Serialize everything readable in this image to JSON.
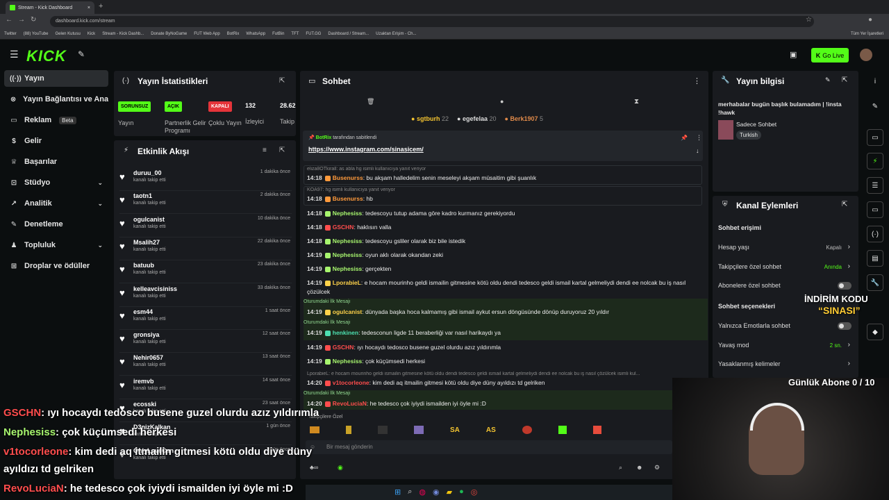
{
  "browser": {
    "tab_title": "Stream - Kick Dashboard",
    "url": "dashboard.kick.com/stream",
    "bookmarks": [
      "Twitter",
      "(88) YouTube",
      "Gelen Kutusu",
      "Kick",
      "Stream - Kick Dashb...",
      "Donate ByNoGame",
      "FUT Web App",
      "BotRix",
      "WhatsApp",
      "FutBin",
      "TFT",
      "FUT.GG",
      "Dashboard / Stream...",
      "Uzaktan Erişim - Ch..."
    ],
    "all_bookmarks": "Tüm Yer İşaretleri"
  },
  "header": {
    "logo": "KICK",
    "go_live": "Go Live"
  },
  "sidebar": {
    "items": [
      {
        "label": "Yayın",
        "icon": "broadcast-icon"
      },
      {
        "label": "Yayın Bağlantısı ve Anahtarı",
        "icon": "link-icon"
      },
      {
        "label": "Reklam",
        "icon": "ad-icon",
        "badge": "Beta"
      },
      {
        "label": "Gelir",
        "icon": "revenue-icon"
      },
      {
        "label": "Başarılar",
        "icon": "trophy-icon"
      },
      {
        "label": "Stüdyo",
        "icon": "studio-icon"
      },
      {
        "label": "Analitik",
        "icon": "analytics-icon"
      },
      {
        "label": "Denetleme",
        "icon": "moderation-icon"
      },
      {
        "label": "Topluluk",
        "icon": "community-icon"
      },
      {
        "label": "Droplar ve ödüller",
        "icon": "gift-icon"
      }
    ]
  },
  "stats": {
    "title": "Yayın İstatistikleri",
    "items": [
      {
        "badge": "SORUNSUZ",
        "label": "Yayın",
        "color": "#53fc18"
      },
      {
        "badge": "AÇIK",
        "label": "Partnerlik Gelir Programı",
        "color": "#53fc18"
      },
      {
        "badge": "KAPALI",
        "label": "Çoklu Yayın",
        "color": "#e5343a"
      },
      {
        "value": "132",
        "label": "İzleyici"
      },
      {
        "value": "28.62",
        "label": "Takip"
      }
    ]
  },
  "activity": {
    "title": "Etkinlik Akışı",
    "sub": "kanalı takip etti",
    "items": [
      {
        "name": "duruu_00",
        "time": "1 dakika önce"
      },
      {
        "name": "taotn1",
        "time": "2 dakika önce"
      },
      {
        "name": "ogulcanist",
        "time": "10 dakika önce"
      },
      {
        "name": "Msalih27",
        "time": "22 dakika önce"
      },
      {
        "name": "batuub",
        "time": "23 dakika önce"
      },
      {
        "name": "kelleavcisiniss",
        "time": "33 dakika önce"
      },
      {
        "name": "esm44",
        "time": "1 saat önce"
      },
      {
        "name": "gronsiya",
        "time": "12 saat önce"
      },
      {
        "name": "Nehir0657",
        "time": "13 saat önce"
      },
      {
        "name": "iremvb",
        "time": "14 saat önce"
      },
      {
        "name": "ecosski",
        "time": "23 saat önce"
      },
      {
        "name": "D3nizKalkan",
        "time": "1 gün önce"
      },
      {
        "name": "OnlyLoveCan",
        "time": "1 gün önce"
      }
    ]
  },
  "chat": {
    "title": "Sohbet",
    "top_users": [
      {
        "name": "sgtburh",
        "count": "22"
      },
      {
        "name": "egefelaa",
        "count": "20"
      },
      {
        "name": "Berk1907",
        "count": "5"
      }
    ],
    "pinned_by": "BotRix",
    "pinned_suffix": "tarafından sabitlendi",
    "pinned_link": "https://www.instagram.com/sinasicem/",
    "first_message_label": "Oturumdaki İlk Mesajı",
    "messages": [
      {
        "reply": "eliza8OTkirall: as abla hg isimli kullanıcıya yanıt veriyor",
        "time": "14:18",
        "user": "Busenurss",
        "color": "#ff9a3c",
        "text": "bu akşam halledelim senin meseleyi akşam müsaitim gibi şuanlık"
      },
      {
        "reply": "KOA97: hg isimli kullanıcıya yanıt veriyor",
        "time": "14:18",
        "user": "Busenurss",
        "color": "#ff9a3c",
        "text": "hb"
      },
      {
        "time": "14:18",
        "user": "Nephesiss",
        "color": "#a7f56e",
        "text": "tedescoyu tutup adama göre kadro kurmanız gerekiyordu"
      },
      {
        "time": "14:18",
        "user": "GSCHN",
        "color": "#ff4d4d",
        "text": "haklısın valla"
      },
      {
        "time": "14:18",
        "user": "Nephesiss",
        "color": "#a7f56e",
        "text": "tedescoyu gsliler olarak biz bile istedik"
      },
      {
        "time": "14:19",
        "user": "Nephesiss",
        "color": "#a7f56e",
        "text": "oyun aklı olarak okandan zeki"
      },
      {
        "time": "14:19",
        "user": "Nephesiss",
        "color": "#a7f56e",
        "text": "gerçekten"
      },
      {
        "time": "14:19",
        "user": "LporabieL",
        "color": "#ffd24a",
        "text": "e hocam mourinho geldi ismailin gitmesine kötü oldu dendi tedesco geldi ismail kartal gelmeliydi dendi ee nolcak bu iş nasıl çözülcek"
      },
      {
        "first": true,
        "time": "14:19",
        "user": "ogulcanist",
        "color": "#ffd24a",
        "text": "dünyada başka hoca kalmamış gibi ismail aykut ersun döngüsünde dönüp duruyoruz 20 yıldır"
      },
      {
        "first": true,
        "time": "14:19",
        "user": "henkinen",
        "color": "#4de0b0",
        "text": "tedesconun ligde 11 beraberliği var nasıl harikaydı ya"
      },
      {
        "time": "14:19",
        "user": "GSCHN",
        "color": "#ff4d4d",
        "text": "ıyı hocaydı tedosco busene guzel olurdu azız yıldırımla"
      },
      {
        "time": "14:19",
        "user": "Nephesiss",
        "color": "#a7f56e",
        "text": "çok küçümsedi herkesi"
      },
      {
        "reply": "LporabieL: e hocam mourinho geldi ismailin gitmesine kötü oldu dendi tedesco geldi ismail kartal gelmeliydi dendi ee nolcak bu iş nasıl çözülcek isimli kul...",
        "time": "14:20",
        "user": "v1tocorleone",
        "color": "#ff4d4d",
        "text": "kim dedi aq itmailin gitmesi kötü oldu diye düny ayıldızı td gelriken"
      },
      {
        "first": true,
        "time": "14:20",
        "user": "RevoLuciaN",
        "color": "#ff4d4d",
        "text": "he tedesco çok iyiydi ismailden iyi öyle mi :D"
      }
    ],
    "followers_only": "Takipçilere Özel",
    "emotes": [
      "SA",
      "AS"
    ],
    "input_placeholder": "Bir mesaj gönderin"
  },
  "stream_info": {
    "title": "Yayın bilgisi",
    "stream_title": "merhabalar bugün başlık bulamadım | !insta !hawk",
    "category": "Sadece Sohbet",
    "tag": "Turkish"
  },
  "channel_actions": {
    "title": "Kanal Eylemleri",
    "chat_access": "Sohbet erişimi",
    "rows1": [
      {
        "label": "Hesap yaşı",
        "value": "Kapalı",
        "color": "#bbbbbb"
      },
      {
        "label": "Takipçilere özel sohbet",
        "value": "Anında",
        "color": "#53fc18"
      },
      {
        "label": "Abonelere özel sohbet",
        "toggle": true
      }
    ],
    "chat_options": "Sohbet seçenekleri",
    "rows2": [
      {
        "label": "Yalnızca Emotlarla sohbet",
        "toggle": true
      },
      {
        "label": "Yavaş mod",
        "value": "2 sn.",
        "color": "#53fc18"
      },
      {
        "label": "Yasaklanmış kelimeler"
      }
    ]
  },
  "overlay": {
    "discount_line1": "İNDİRİM KODU",
    "discount_line2": "“SINASI”",
    "sub_goal": "Günlük Abone 0 / 10",
    "chat": [
      {
        "user": "GSCHN",
        "color": "#ff4d4d",
        "text": ": ıyı hocaydı tedosco busene guzel olurdu azız yıldırımla"
      },
      {
        "user": "Nephesiss",
        "color": "#a7f56e",
        "text": ": çok küçümsedi herkesi"
      },
      {
        "user": "v1tocorleone",
        "color": "#ff4d4d",
        "text": ": kim dedi aq itmailin gitmesi kötü oldu diye düny"
      },
      {
        "user": "",
        "color": "#ffffff",
        "text": "ayıldızı td gelriken"
      },
      {
        "user": "RevoLuciaN",
        "color": "#ff4d4d",
        "text": ": he tedesco çok iyiydi ismailden iyi öyle mi :D"
      }
    ]
  }
}
